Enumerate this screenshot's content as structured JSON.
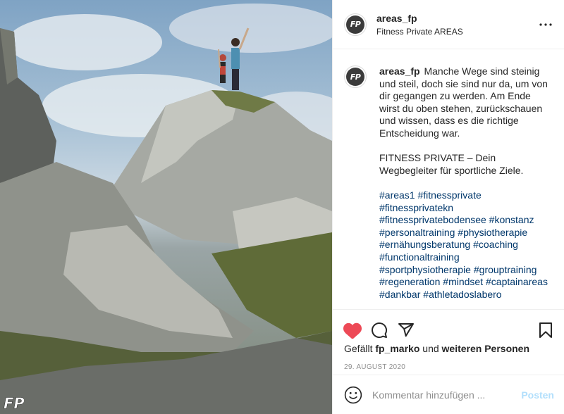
{
  "post": {
    "username": "areas_fp",
    "location": "Fitness Private AREAS",
    "avatar_text": "FP",
    "caption_user": "areas_fp",
    "caption_p1": "Manche Wege sind steinig und steil, doch sie sind nur da, um von dir gegangen zu werden. Am Ende wirst du oben stehen, zurückschauen und wissen, dass es die richtige Entscheidung war.",
    "caption_p2": "FITNESS PRIVATE – Dein Wegbegleiter für sportliche Ziele.",
    "hashtags": [
      "#areas1",
      "#fitnessprivate",
      "#fitnessprivatekn",
      "#fitnessprivatebodensee",
      "#konstanz",
      "#personaltraining",
      "#physiotherapie",
      "#ernähungsberatung",
      "#coaching",
      "#functionaltraining",
      "#sportphysiotherapie",
      "#grouptraining",
      "#regeneration",
      "#mindset",
      "#captainareas",
      "#dankbar",
      "#athletadoslabero"
    ],
    "liked_prefix": "Gefällt",
    "liked_user": "fp_marko",
    "liked_mid": "und",
    "liked_others": "weiteren Personen",
    "date": "29. AUGUST 2020",
    "comment_placeholder": "Kommentar hinzufügen ...",
    "post_label": "Posten",
    "watermark_text": "FP"
  },
  "colors": {
    "like_red": "#ed4956",
    "hashtag": "#00376b",
    "post_disabled": "#b2dffc",
    "muted": "#8e8e8e"
  },
  "icons": {
    "more": "more-icon",
    "like": "heart-filled-icon",
    "comment": "comment-icon",
    "share": "share-icon",
    "save": "bookmark-icon",
    "emoji": "emoji-icon"
  }
}
